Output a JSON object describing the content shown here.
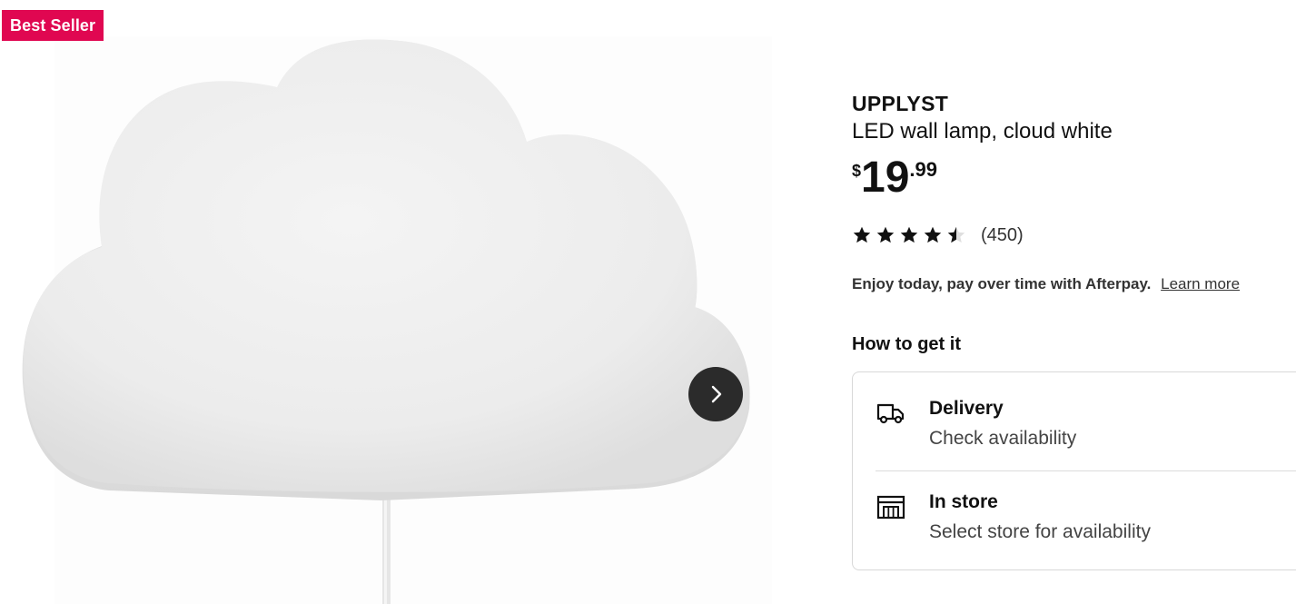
{
  "badge": {
    "label": "Best Seller",
    "color": "#e00751"
  },
  "gallery": {
    "next_icon": "chevron-right-icon"
  },
  "product": {
    "name": "UPPLYST",
    "description": "LED wall lamp, cloud white",
    "price": {
      "currency": "$",
      "integer": "19",
      "decimal": ".99"
    },
    "rating": {
      "value": 4.5,
      "max": 5,
      "count_text": "(450)"
    }
  },
  "afterpay": {
    "text": "Enjoy today, pay over time with Afterpay.",
    "link": "Learn more"
  },
  "how_to_get": {
    "heading": "How to get it",
    "options": [
      {
        "icon": "truck-icon",
        "title": "Delivery",
        "subtitle": "Check availability"
      },
      {
        "icon": "store-icon",
        "title": "In store",
        "subtitle": "Select store for availability"
      }
    ]
  }
}
